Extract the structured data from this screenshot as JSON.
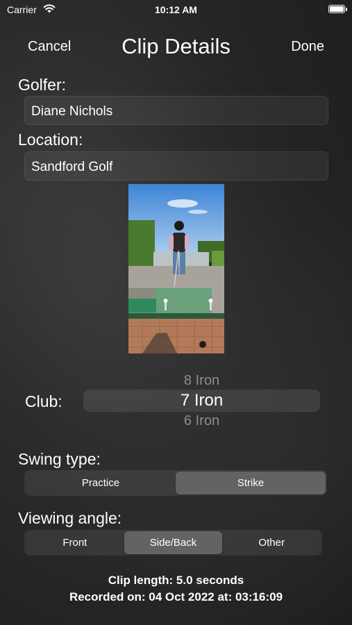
{
  "status_bar": {
    "carrier": "Carrier",
    "time": "10:12 AM",
    "battery_level": 1.0
  },
  "nav": {
    "cancel_label": "Cancel",
    "title": "Clip Details",
    "done_label": "Done"
  },
  "golfer": {
    "label": "Golfer:",
    "value": "Diane Nichols"
  },
  "location": {
    "label": "Location:",
    "value": "Sandford Golf"
  },
  "club": {
    "label": "Club:",
    "options_above": "8 Iron",
    "selected": "7 Iron",
    "options_below": "6 Iron"
  },
  "swing_type": {
    "label": "Swing type:",
    "options": [
      "Practice",
      "Strike"
    ],
    "selected_index": 1
  },
  "viewing_angle": {
    "label": "Viewing angle:",
    "options": [
      "Front",
      "Side/Back",
      "Other"
    ],
    "selected_index": 1
  },
  "footer": {
    "clip_length": "Clip length: 5.0 seconds",
    "recorded_on": "Recorded on: 04 Oct 2022 at: 03:16:09"
  }
}
